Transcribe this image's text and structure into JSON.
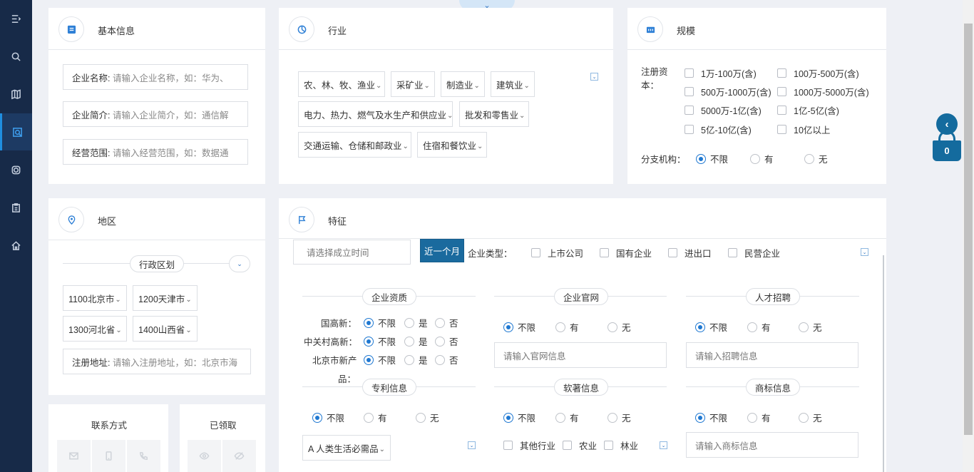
{
  "basic": {
    "title": "基本信息",
    "company_name_label": "企业名称:",
    "company_name_placeholder": "请输入企业名称，如：华为、",
    "company_intro_label": "企业简介:",
    "company_intro_placeholder": "请输入企业简介，如：通信解",
    "scope_label": "经营范围:",
    "scope_placeholder": "请输入经营范围，如：数据通"
  },
  "industry": {
    "title": "行业",
    "items": [
      "农、林、牧、渔业",
      "采矿业",
      "制造业",
      "建筑业",
      "电力、热力、燃气及水生产和供应业",
      "批发和零售业",
      "交通运输、仓储和邮政业",
      "住宿和餐饮业"
    ]
  },
  "scale": {
    "title": "规模",
    "capital_label": "注册资本：",
    "capital_options": [
      "1万-100万(含)",
      "100万-500万(含)",
      "500万-1000万(含)",
      "1000万-5000万(含)",
      "5000万-1亿(含)",
      "1亿-5亿(含)",
      "5亿-10亿(含)",
      "10亿以上"
    ],
    "branch_label": "分支机构：",
    "branch_options": [
      "不限",
      "有",
      "无"
    ]
  },
  "region": {
    "title": "地区",
    "admin_label": "行政区划",
    "provinces": [
      "1100北京市",
      "1200天津市",
      "1300河北省",
      "1400山西省"
    ],
    "address_label": "注册地址:",
    "address_placeholder": "请输入注册地址，如：北京市海"
  },
  "features": {
    "title": "特征",
    "date_placeholder": "请选择成立时间",
    "recent_btn": "近一个月",
    "company_type_label": "企业类型：",
    "company_types": [
      "上市公司",
      "国有企业",
      "进出口",
      "民营企业"
    ],
    "qualification": {
      "title": "企业资质",
      "rows": [
        {
          "label": "国高新："
        },
        {
          "label": "中关村高新："
        },
        {
          "label": "北京市新产",
          "label2": "品："
        }
      ],
      "options": [
        "不限",
        "是",
        "否"
      ]
    },
    "website": {
      "title": "企业官网",
      "options": [
        "不限",
        "有",
        "无"
      ],
      "placeholder": "请输入官网信息"
    },
    "recruit": {
      "title": "人才招聘",
      "options": [
        "不限",
        "有",
        "无"
      ],
      "placeholder": "请输入招聘信息"
    },
    "patent": {
      "title": "专利信息",
      "options": [
        "不限",
        "有",
        "无"
      ],
      "select": "A 人类生活必需品"
    },
    "software": {
      "title": "软著信息",
      "options": [
        "不限",
        "有",
        "无"
      ],
      "checks": [
        "其他行业",
        "农业",
        "林业"
      ]
    },
    "trademark": {
      "title": "商标信息",
      "options": [
        "不限",
        "有",
        "无"
      ],
      "placeholder": "请输入商标信息"
    }
  },
  "contact": {
    "title": "联系方式"
  },
  "claimed": {
    "title": "已领取"
  },
  "basket": {
    "count": "0"
  },
  "colors": {
    "sidebar": "#172a48",
    "accent": "#1f78d1",
    "button": "#1a6a9e"
  }
}
